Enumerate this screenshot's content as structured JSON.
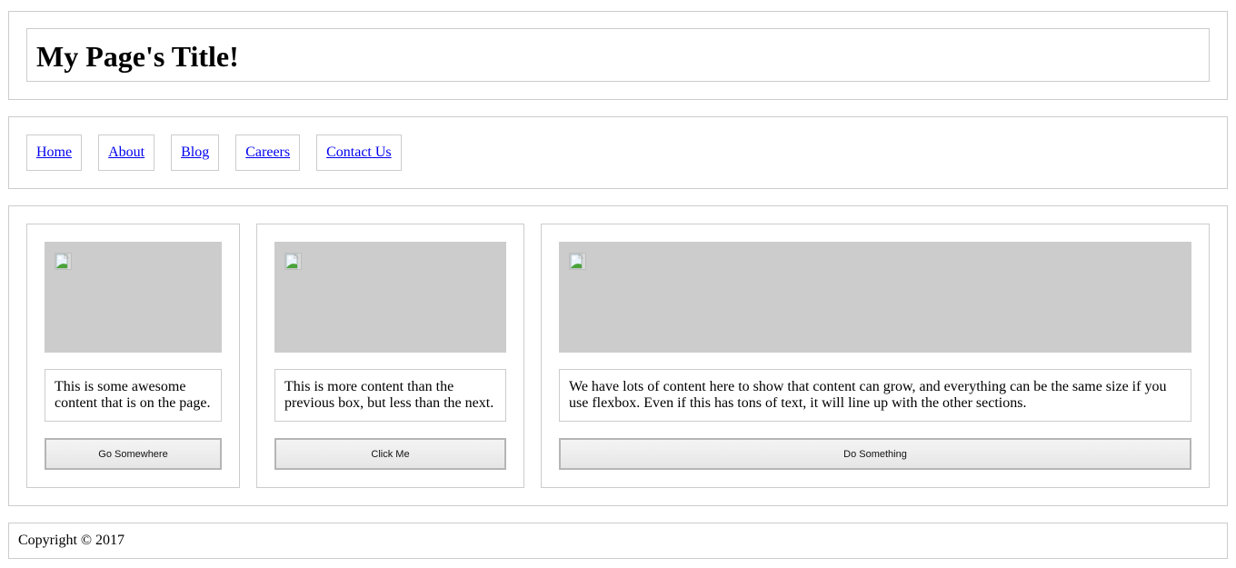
{
  "header": {
    "title": "My Page's Title!"
  },
  "nav": {
    "items": [
      {
        "label": "Home"
      },
      {
        "label": "About"
      },
      {
        "label": "Blog"
      },
      {
        "label": "Careers"
      },
      {
        "label": "Contact Us"
      }
    ]
  },
  "main": {
    "cards": [
      {
        "image_icon": "broken-image-icon",
        "text": "This is some awesome content that is on the page.",
        "button_label": "Go Somewhere"
      },
      {
        "image_icon": "broken-image-icon",
        "text": "This is more content than the previous box, but less than the next.",
        "button_label": "Click Me"
      },
      {
        "image_icon": "broken-image-icon",
        "text": "We have lots of content here to show that content can grow, and everything can be the same size if you use flexbox. Even if this has tons of text, it will line up with the other sections.",
        "button_label": "Do Something"
      }
    ]
  },
  "footer": {
    "copyright": "Copyright © 2017"
  },
  "colors": {
    "border": "#cccccc",
    "image_placeholder": "#cccccc",
    "link": "#0000ee"
  }
}
